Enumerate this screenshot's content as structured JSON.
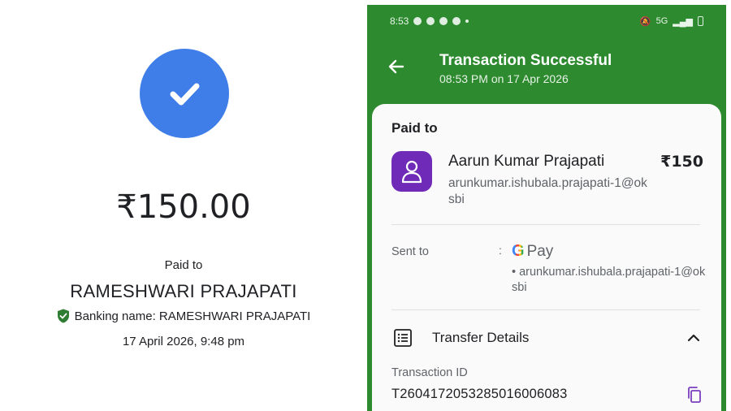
{
  "left": {
    "amount": "₹150.00",
    "paid_to_label": "Paid to",
    "payee_name": "RAMESHWARI PRAJAPATI",
    "banking_name": "Banking name: RAMESHWARI PRAJAPATI",
    "datetime": "17 April 2026, 9:48 pm",
    "icons": {
      "status": "check-icon",
      "verified": "shield-check-icon"
    },
    "colors": {
      "check_circle": "#3f7ee8",
      "shield": "#2e7d32"
    }
  },
  "right": {
    "statusbar": {
      "time": "8:53",
      "network": "5G"
    },
    "appbar": {
      "title": "Transaction Successful",
      "subtitle": "08:53 PM on 17 Apr 2026"
    },
    "paid_to": {
      "heading": "Paid to",
      "name": "Aarun Kumar Prajapati",
      "amount": "₹150",
      "upi": "arunkumar.ishubala.prajapati-1@oksbi"
    },
    "sent_to": {
      "label": "Sent to",
      "colon": ":",
      "app_g": "G",
      "app_pay": "Pay",
      "upi": "• arunkumar.ishubala.prajapati-1@oksbi"
    },
    "transfer_details": {
      "label": "Transfer Details",
      "txn_label": "Transaction ID",
      "txn_id": "T2604172053285016006083"
    },
    "colors": {
      "header_green": "#2d8a2f",
      "avatar_purple": "#6f2ab8"
    }
  }
}
